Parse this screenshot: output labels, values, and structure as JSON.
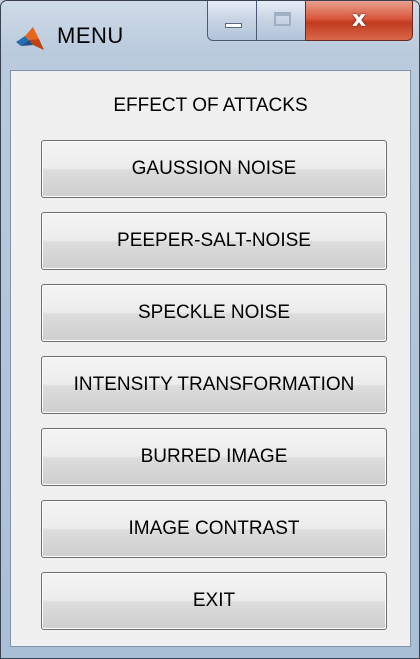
{
  "window": {
    "title": "MENU",
    "icon": "matlab-icon",
    "controls": {
      "minimize_icon": "minimize-icon",
      "maximize_icon": "maximize-icon",
      "close_label": "x"
    }
  },
  "heading": "EFFECT OF ATTACKS",
  "buttons": [
    {
      "label": "GAUSSION NOISE"
    },
    {
      "label": "PEEPER-SALT-NOISE"
    },
    {
      "label": "SPECKLE NOISE"
    },
    {
      "label": "INTENSITY TRANSFORMATION"
    },
    {
      "label": "BURRED IMAGE"
    },
    {
      "label": "IMAGE CONTRAST"
    },
    {
      "label": "EXIT"
    }
  ]
}
